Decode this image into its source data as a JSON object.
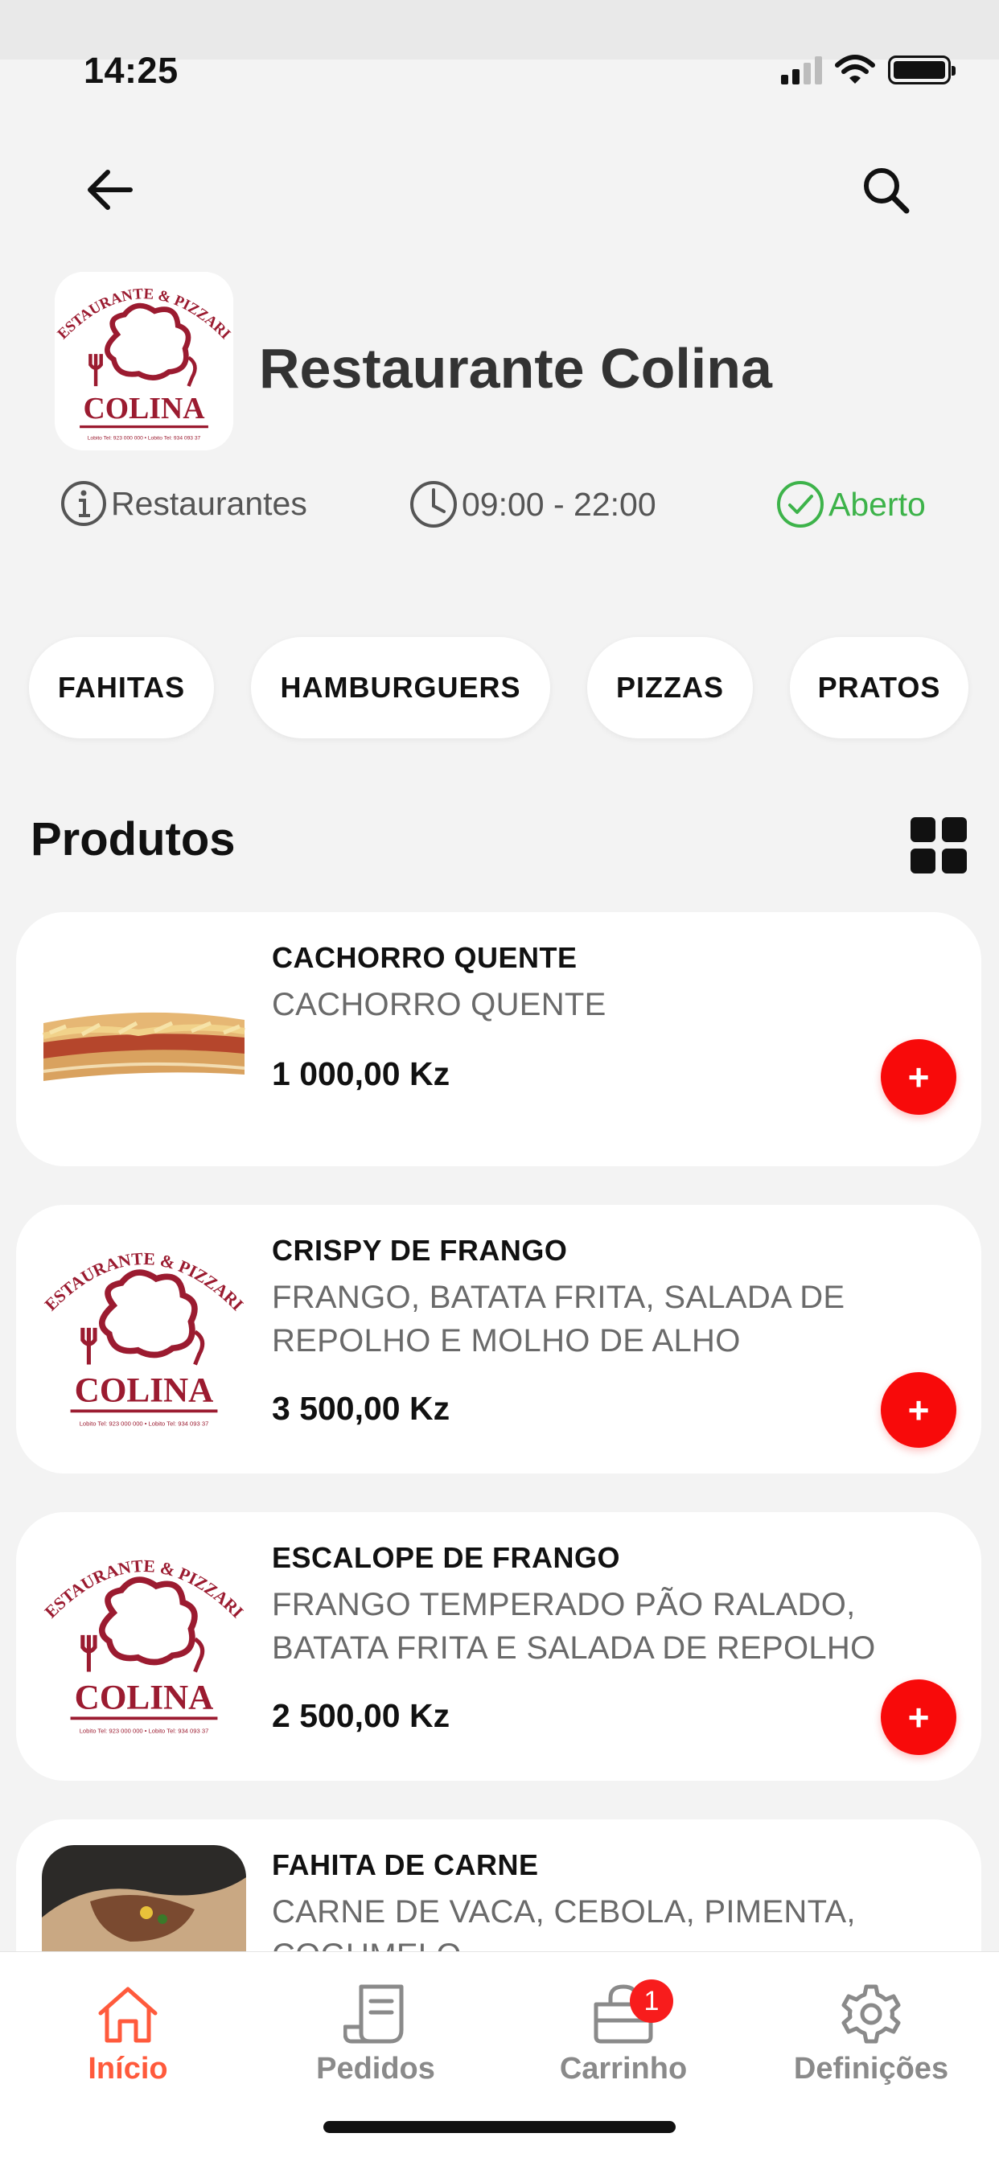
{
  "status_bar": {
    "time": "14:25"
  },
  "header": {
    "back_icon": "arrow-left-icon",
    "search_icon": "search-icon"
  },
  "store": {
    "name": "Restaurante Colina",
    "logo": {
      "arc_text": "RESTAURANTE & PIZZARIA",
      "name": "COLINA",
      "footer": "Lobito Tel: 923 000 000 • Lobito Tel: 934 093 37"
    },
    "category": "Restaurantes",
    "hours": "09:00 - 22:00",
    "status": "Aberto",
    "colors": {
      "open": "#3db34a",
      "accent": "#ff5a3c",
      "add_button": "#f80a0a",
      "logo": "#9b1b30"
    }
  },
  "categories": [
    "FAHITAS",
    "HAMBURGUERS",
    "PIZZAS",
    "PRATOS"
  ],
  "products_section": {
    "title": "Produtos",
    "view_icon": "grid-view-icon"
  },
  "products": [
    {
      "name": "CACHORRO QUENTE",
      "description": "CACHORRO QUENTE",
      "price": "1 000,00 Kz",
      "add_label": "+",
      "image": "hot-dog-photo"
    },
    {
      "name": "CRISPY DE FRANGO",
      "description": "FRANGO, BATATA FRITA, SALADA DE REPOLHO E MOLHO DE ALHO",
      "price": "3 500,00 Kz",
      "add_label": "+",
      "image": "colina-logo"
    },
    {
      "name": "ESCALOPE DE FRANGO",
      "description": "FRANGO TEMPERADO PÃO RALADO, BATATA FRITA E SALADA DE REPOLHO",
      "price": "2 500,00 Kz",
      "add_label": "+",
      "image": "colina-logo"
    },
    {
      "name": "FAHITA DE CARNE",
      "description": "CARNE DE VACA, CEBOLA, PIMENTA, COGUMELO",
      "price": "",
      "add_label": "+",
      "image": "fahita-photo"
    }
  ],
  "tabbar": {
    "items": [
      {
        "label": "Início",
        "icon": "home-icon",
        "active": true
      },
      {
        "label": "Pedidos",
        "icon": "receipt-icon",
        "active": false
      },
      {
        "label": "Carrinho",
        "icon": "cart-bag-icon",
        "active": false,
        "badge": "1"
      },
      {
        "label": "Definições",
        "icon": "gear-icon",
        "active": false
      }
    ]
  }
}
